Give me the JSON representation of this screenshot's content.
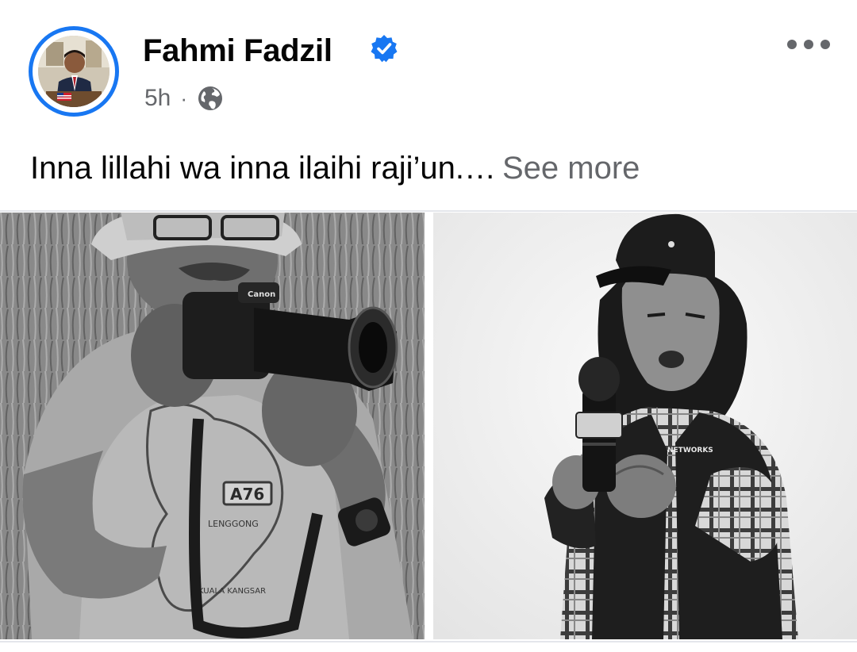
{
  "post": {
    "author": {
      "name": "Fahmi Fadzil",
      "verified": true,
      "avatar_icon": "profile-photo"
    },
    "timestamp": "5h",
    "separator": "·",
    "audience_icon": "globe-icon",
    "text": "Inna lillahi wa inna ilaihi raji’un.…",
    "see_more_label": "See more",
    "menu_icon": "more-horizontal-icon"
  },
  "photos": [
    {
      "position": "left",
      "camera_brand": "Canon",
      "shirt_print": "A76",
      "shirt_text_1": "LENGGONG",
      "shirt_text_2": "KUALA KANGSAR"
    },
    {
      "position": "right",
      "vest_text": "NETWORKS"
    }
  ],
  "colors": {
    "accent": "#1877f2",
    "text_primary": "#050505",
    "text_secondary": "#65676b",
    "divider": "#e4e6eb"
  }
}
